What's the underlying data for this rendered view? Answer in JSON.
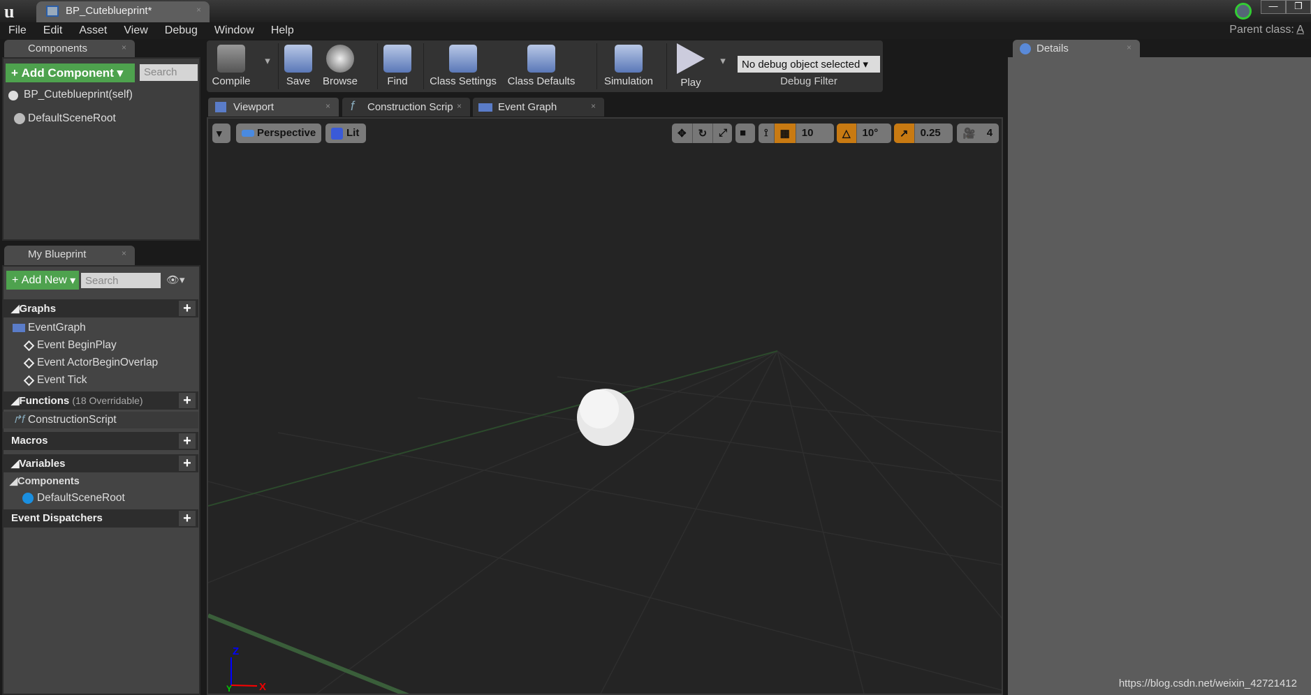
{
  "window": {
    "doc_tab": "BP_Cuteblueprint*",
    "parent_class_label": "Parent class:",
    "parent_class_value": "A"
  },
  "menu": [
    "File",
    "Edit",
    "Asset",
    "View",
    "Debug",
    "Window",
    "Help"
  ],
  "components": {
    "tab": "Components",
    "add_label": "Add Component",
    "search_placeholder": "Search",
    "items": [
      "BP_Cuteblueprint(self)",
      "DefaultSceneRoot"
    ]
  },
  "my_blueprint": {
    "tab": "My Blueprint",
    "add_label": "Add New",
    "search_placeholder": "Search",
    "graphs": {
      "label": "Graphs",
      "event_graph": "EventGraph",
      "events": [
        "Event BeginPlay",
        "Event ActorBeginOverlap",
        "Event Tick"
      ]
    },
    "functions": {
      "label": "Functions",
      "count": "(18 Overridable)",
      "items": [
        "ConstructionScript"
      ]
    },
    "macros": "Macros",
    "variables": "Variables",
    "var_components": "Components",
    "var_items": [
      "DefaultSceneRoot"
    ],
    "dispatchers": "Event Dispatchers"
  },
  "toolbar": {
    "compile": "Compile",
    "save": "Save",
    "browse": "Browse",
    "find": "Find",
    "class_settings": "Class Settings",
    "class_defaults": "Class Defaults",
    "simulation": "Simulation",
    "play": "Play",
    "debug_select": "No debug object selected",
    "debug_filter": "Debug Filter"
  },
  "editor_tabs": [
    "Viewport",
    "Construction Scrip",
    "Event Graph"
  ],
  "viewport": {
    "perspective": "Perspective",
    "lit": "Lit",
    "grid_snap": "10",
    "rot_snap": "10°",
    "scale_snap": "0.25",
    "camera_speed": "4",
    "axis_x": "X",
    "axis_y": "Y",
    "axis_z": "Z"
  },
  "details": {
    "tab": "Details"
  },
  "watermark": "https://blog.csdn.net/weixin_42721412"
}
